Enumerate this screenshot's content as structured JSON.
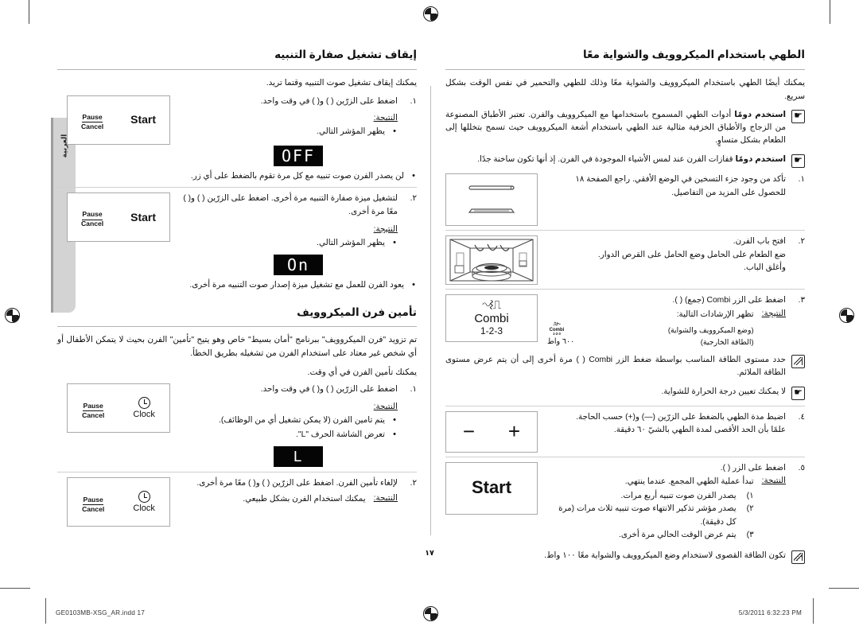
{
  "document": {
    "page_number": "١٧",
    "language_tab": "العربية",
    "footer_file": "GE0103MB-XSG_AR.indd   17",
    "footer_date": "5/3/2011   6:32:23 PM"
  },
  "right_column": {
    "title": "الطهي باستخدام الميكروويف والشواية معًا",
    "intro": "يمكنك أيضًا الطهي باستخدام الميكروويف والشواية معًا وذلك للطهي والتحمير في نفس الوقت بشكل سريع.",
    "notes": [
      {
        "icon": "hand-icon",
        "bold": "استخدم دومًا",
        "text": " أدوات الطهي المسموح باستخدامها مع الميكروويف والفرن. تعتبر الأطباق المصنوعة من الزجاج والأطباق الخزفية مثالية عند الطهي باستخدام أشعة الميكروويف حيث تسمح بتخللها إلى الطعام بشكل متساوٍ."
      },
      {
        "icon": "hand-icon",
        "bold": "استخدم دومًا",
        "text": " قفازات الفرن عند لمس الأشياء الموجودة في الفرن. إذ أنها تكون ساخنة جدًا."
      }
    ],
    "steps": [
      {
        "num": "١.",
        "lines": [
          "تأكد من وجود جزء التسخين في الوضع الأفقي. راجع الصفحة ١٨",
          "للحصول على المزيد من التفاصيل."
        ],
        "figure": "oven-heater-horizontal"
      },
      {
        "num": "٢.",
        "lines": [
          "افتح باب الفرن.",
          "ضع الطعام على الحامل وضع الحامل على القرص الدوار.",
          "وأغلق الباب."
        ],
        "figure": "oven-interior"
      },
      {
        "num": "٣.",
        "lines": [
          "اضغط على الزر Combi (جمع) (   )."
        ],
        "result_label": "النتيجة:",
        "result_text": "تظهر الإرشادات التالية:",
        "result_detail_1": "(وضع الميكروويف والشواية)",
        "result_detail_2": "(الطاقة الخارجية)",
        "result_power": "٦٠٠ واط",
        "figure": "combi-button"
      },
      {
        "num": "٤.",
        "lines": [
          "اضبط مدة الطهي بالضغط على الزرّين (—) و(+) حسب الحاجة.",
          "علمًا بأن الحد الأقصى لمدة الطهي بالشيّ ٦٠ دقيقة."
        ],
        "figure": "plus-minus-button"
      },
      {
        "num": "٥.",
        "lines": [
          "اضغط على الزر (   )."
        ],
        "result_label": "النتيجة:",
        "result_text": "تبدأ عملية الطهي المجمع. عندما ينتهي.",
        "sub_items": [
          {
            "n": "١)",
            "t": "يصدر الفرن صوت تنبيه أربع مرات."
          },
          {
            "n": "٢)",
            "t": "يصدر مؤشر تذكير الانتهاء صوت تنبيه ثلاث مرات (مرة كل دقيقة)."
          },
          {
            "n": "٣)",
            "t": "يتم عرض الوقت الحالي مرة أخرى."
          }
        ],
        "figure": "start-button"
      }
    ],
    "notes_mid": [
      {
        "icon": "pencil-note-icon",
        "text": "حدد مستوى الطاقة المناسب بواسطة ضغط الزر Combi (   ) مرة أخرى إلى أن يتم عرض مستوى الطاقة الملائم."
      },
      {
        "icon": "hand-icon",
        "text": "لا يمكنك تعيين درجة الحرارة للشواية."
      }
    ],
    "note_end": {
      "icon": "pencil-note-icon",
      "text": "تكون الطاقة القصوى لاستخدام وضع الميكروويف والشواية معًا ١٠٠ واط."
    },
    "combi_figure": {
      "icon": "grill-microwave-icon",
      "name": "Combi",
      "number": "1-2-3"
    },
    "start_figure": {
      "label": "Start"
    },
    "plus_minus_figure": {
      "minus": "−",
      "plus": "+"
    }
  },
  "left_column": {
    "section_1": {
      "title": "إيقاف تشغيل صفارة التنبيه",
      "intro": "يمكنك إيقاف تشغيل صوت التنبيه وقتما تريد.",
      "steps": [
        {
          "num": "١.",
          "text": "اضغط على الزرّين (   ) و(   ) في وقت واحد.",
          "result_label": "النتيجة:",
          "bullets": [
            "يظهر المؤشر التالي."
          ],
          "lcd": "OFF",
          "after_bullets": [
            "لن يصدر الفرن صوت تنبيه مع كل مرة تقوم بالضغط على أي زر."
          ],
          "figure": {
            "left_btn_top": "Pause",
            "left_btn_bot": "Cancel",
            "right_btn": "Start"
          }
        },
        {
          "num": "٢.",
          "text": "لتشغيل ميزة صفارة التنبيه مرة أخرى. اضغط على الزرّين (   ) و(   ) معًا مرة أخرى.",
          "result_label": "النتيجة:",
          "bullets": [
            "يظهر المؤشر التالي."
          ],
          "lcd": "On",
          "after_bullets": [
            "يعود الفرن للعمل مع تشغيل ميزة إصدار صوت التنبيه مرة أخرى."
          ],
          "figure": {
            "left_btn_top": "Pause",
            "left_btn_bot": "Cancel",
            "right_btn": "Start"
          }
        }
      ]
    },
    "section_2": {
      "title": "تأمين فرن الميكروويف",
      "intro": "تم تزويد \"فرن الميكروويف\" ببرنامج \"أمان بسيط\" خاص وهو يتيح \"تأمين\" الفرن بحيث لا يتمكن الأطفال أو أي شخص غير معتاد على استخدام الفرن من تشغيله بطريق الخطأ.",
      "intro2": "يمكنك تأمين الفرن في أي وقت.",
      "steps": [
        {
          "num": "١.",
          "text": "اضغط على الزرّين (   ) و(   ) في وقت واحد.",
          "result_label": "النتيجة:",
          "bullets": [
            "يتم تامين الفرن (لا يمكن تشغيل أي من الوظائف).",
            "تعرض الشاشة الحرف \"L\"."
          ],
          "lcd": "L",
          "figure": {
            "left_btn_top": "Pause",
            "left_btn_bot": "Cancel",
            "right_btn": "Clock"
          }
        },
        {
          "num": "٢.",
          "text": "لإلغاء تأمين الفرن. اضغط على الزرّين (   ) و(   ) معًا مرة أخرى.",
          "result_label": "النتيجة:",
          "result_text": "يمكنك استخدام الفرن بشكل طبيعي.",
          "figure": {
            "left_btn_top": "Pause",
            "left_btn_bot": "Cancel",
            "right_btn": "Clock"
          }
        }
      ]
    }
  }
}
